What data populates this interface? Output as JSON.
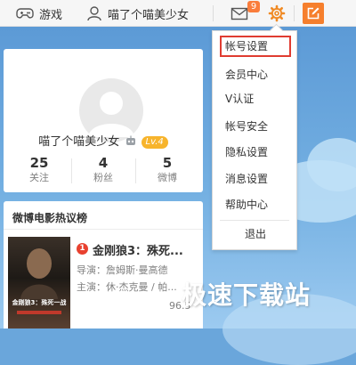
{
  "topbar": {
    "game_label": "游戏",
    "username": "喵了个喵美少女",
    "mail_count": "9"
  },
  "profile": {
    "nickname": "喵了个喵美少女",
    "level": "Lv.4",
    "stats": [
      {
        "value": "25",
        "label": "关注"
      },
      {
        "value": "4",
        "label": "粉丝"
      },
      {
        "value": "5",
        "label": "微博"
      }
    ]
  },
  "movie_box": {
    "title": "微博电影热议榜",
    "rank": "1",
    "name": "金刚狼3：殊死...",
    "director": "导演：詹姆斯·曼高德",
    "cast": "主演：休·杰克曼 / 帕...",
    "score": "96.5",
    "poster_text": "金刚狼3：殊死一战"
  },
  "menu": {
    "items": [
      {
        "label": "帐号设置",
        "active": true
      },
      {
        "label": "会员中心"
      },
      {
        "label": "V认证"
      },
      {
        "label": "帐号安全"
      },
      {
        "label": "隐私设置"
      },
      {
        "label": "消息设置"
      },
      {
        "label": "帮助中心"
      },
      {
        "label": "退出"
      }
    ]
  },
  "watermark": "极速下载站",
  "colors": {
    "accent": "#fa7d3c",
    "menu_highlight": "#e03c31",
    "background": "#6aa6db"
  }
}
